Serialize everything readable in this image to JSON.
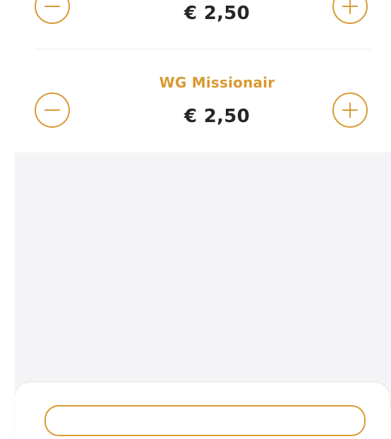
{
  "colors": {
    "accent": "#d89a33",
    "price_text": "#262626",
    "background_empty": "#f4f4f6",
    "divider": "#ececec"
  },
  "items": [
    {
      "name": "",
      "price": "€ 2,50",
      "minus_icon": "minus-circle-icon",
      "plus_icon": "plus-circle-icon"
    },
    {
      "name": "WG Missionair",
      "price": "€ 2,50",
      "minus_icon": "minus-circle-icon",
      "plus_icon": "plus-circle-icon"
    }
  ]
}
